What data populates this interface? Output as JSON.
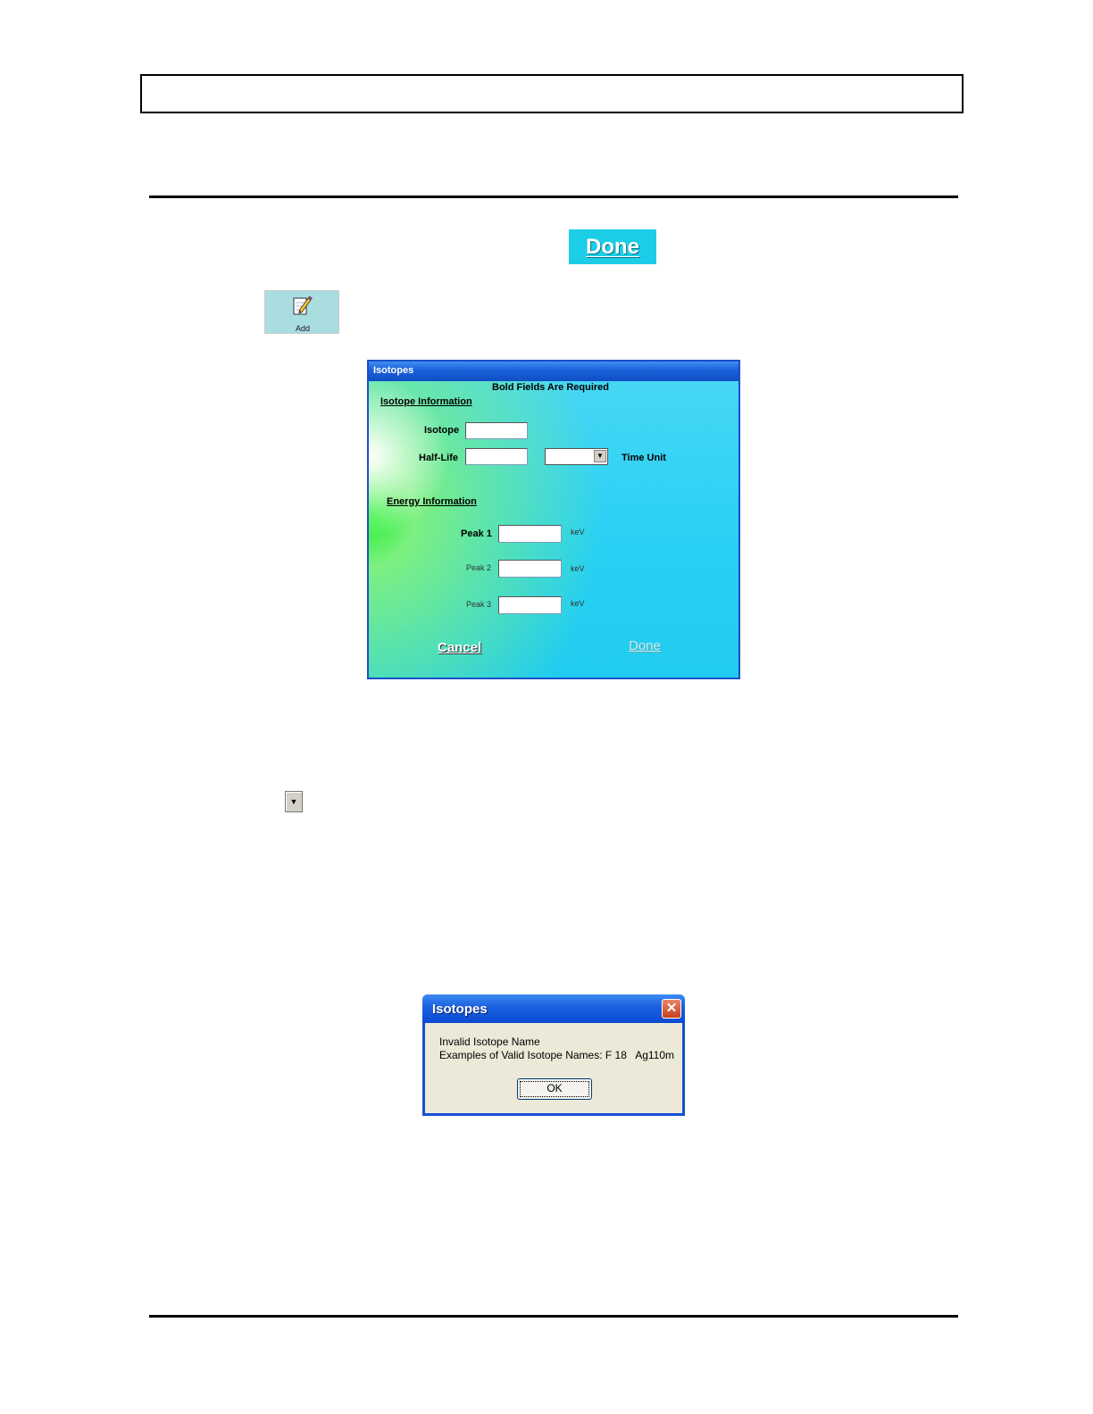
{
  "buttons": {
    "done_label": "Done",
    "add_label": "Add"
  },
  "isotopes_dialog": {
    "title": "Isotopes",
    "required_note": "Bold Fields Are Required",
    "section_isotope": "Isotope Information",
    "isotope_label": "Isotope",
    "isotope_value": "",
    "half_life_label": "Half-Life",
    "half_life_value": "",
    "time_unit_value": "",
    "time_unit_label": "Time Unit",
    "section_energy": "Energy Information",
    "peaks": [
      {
        "label": "Peak 1",
        "value": "",
        "unit": "keV"
      },
      {
        "label": "Peak 2",
        "value": "",
        "unit": "keV"
      },
      {
        "label": "Peak 3",
        "value": "",
        "unit": "keV"
      }
    ],
    "cancel_label": "Cancel",
    "done_label": "Done"
  },
  "message_dialog": {
    "title": "Isotopes",
    "line1": "Invalid Isotope Name",
    "line2": "Examples of Valid Isotope Names: F 18   Ag110m",
    "ok_label": "OK"
  },
  "icons": {
    "add": "notepad-pencil-icon",
    "close": "close-icon",
    "dropdown": "dropdown-arrow-icon"
  },
  "colors": {
    "done_chip": "#1ccde8",
    "dialog_bg": "#28d0f3",
    "titlebar": "#1a5fd8",
    "msg_bg": "#ece9d8"
  }
}
